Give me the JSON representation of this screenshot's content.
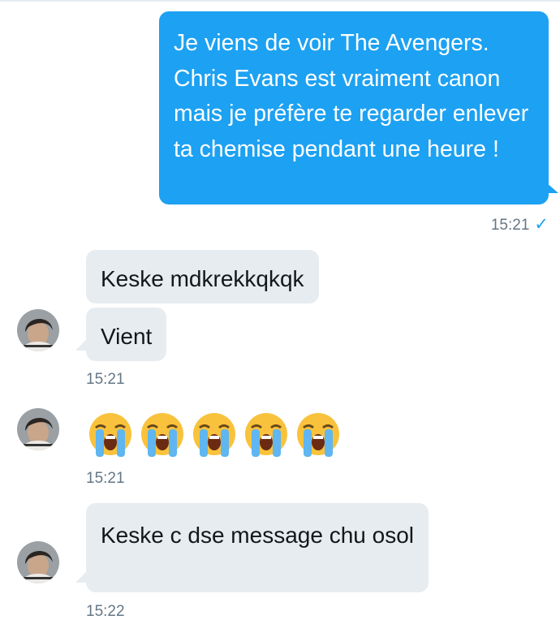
{
  "conversation": {
    "sent_message": {
      "text": "Je viens de voir The Avengers. Chris Evans est vraiment canon mais je préfère te regarder enlever ta chemise pendant une heure !",
      "time": "15:21",
      "read_mark": "✓"
    },
    "group1": {
      "messages": [
        "Keske mdkrekkqkqk",
        "Vient"
      ],
      "time": "15:21"
    },
    "group2": {
      "emoji": [
        "loudly-crying-face",
        "loudly-crying-face",
        "loudly-crying-face",
        "loudly-crying-face",
        "loudly-crying-face"
      ],
      "time": "15:21"
    },
    "group3": {
      "message": "Keske c dse message chu osol",
      "time": "15:22"
    }
  },
  "colors": {
    "sent_bubble": "#1da1f2",
    "received_bubble": "#e6ecf0",
    "timestamp": "#657786"
  }
}
